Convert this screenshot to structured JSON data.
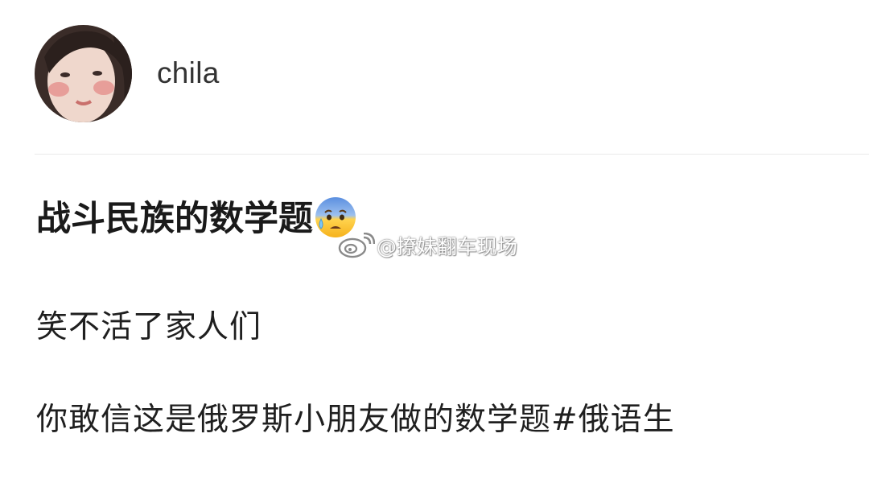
{
  "author": {
    "username": "chila"
  },
  "post": {
    "title": "战斗民族的数学题",
    "title_emoji": "anxious-face-with-sweat-icon",
    "lines": [
      "笑不活了家人们",
      "你敢信这是俄罗斯小朋友做的数学题#俄语生"
    ]
  },
  "watermark": {
    "text": "@撩妹翻车现场"
  }
}
